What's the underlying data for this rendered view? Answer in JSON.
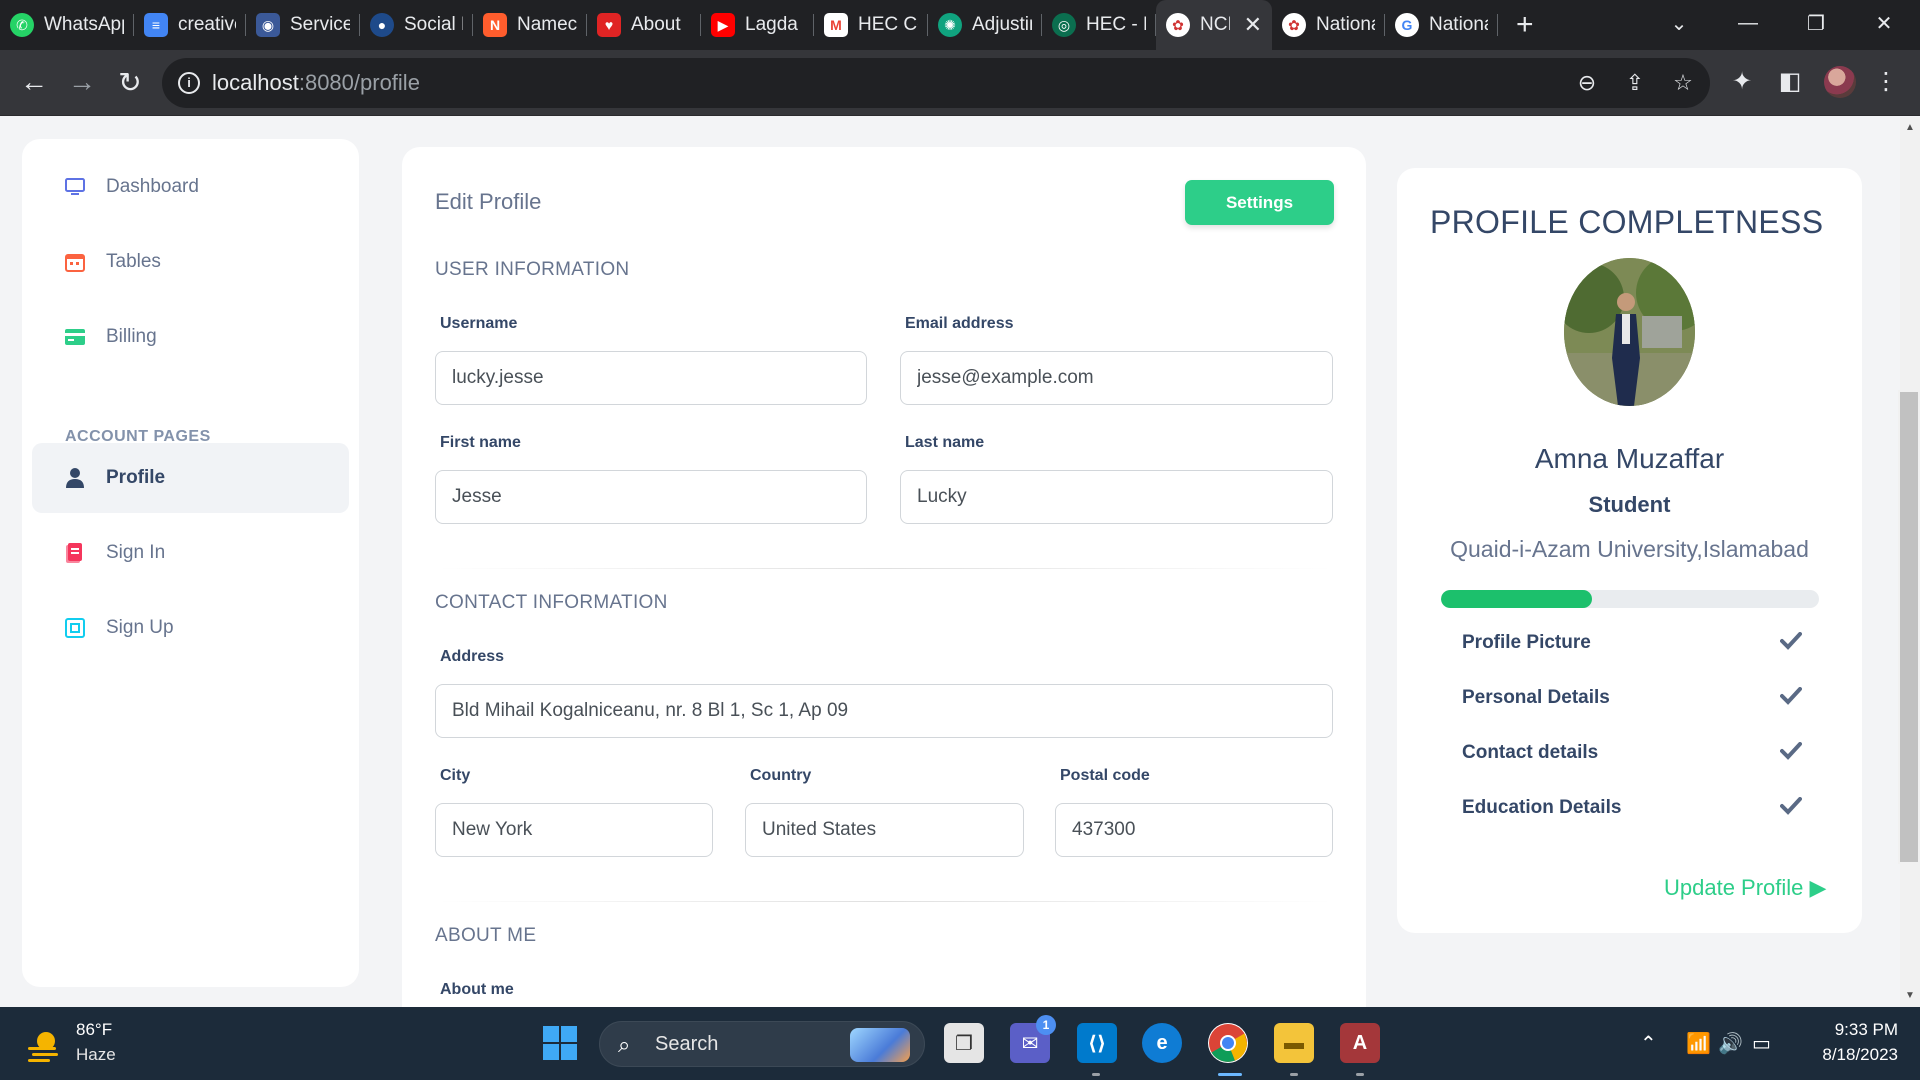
{
  "browser": {
    "tabs": [
      {
        "label": "WhatsApp",
        "color": "#25d366",
        "icon": "whatsapp-icon"
      },
      {
        "label": "creative",
        "color": "#4285f4",
        "icon": "docs-icon"
      },
      {
        "label": "Services",
        "color": "#3b5998",
        "icon": "services-icon"
      },
      {
        "label": "Social Media",
        "color": "#1e4a8a",
        "icon": "social-icon"
      },
      {
        "label": "Namecheap",
        "color": "#ff5d2d",
        "icon": "namecheap-icon"
      },
      {
        "label": "About",
        "color": "#e02424",
        "icon": "about-icon"
      },
      {
        "label": "Lagda",
        "color": "#ff0000",
        "icon": "youtube-icon"
      },
      {
        "label": "HEC Core",
        "color": "#ea4335",
        "icon": "gmail-icon"
      },
      {
        "label": "Adjusting",
        "color": "#10a37f",
        "icon": "chatgpt-icon"
      },
      {
        "label": "HEC - Portal",
        "color": "#0b6e4f",
        "icon": "hec-icon"
      },
      {
        "label": "NCI",
        "color": "#d03232",
        "icon": "nci-icon",
        "active": true
      },
      {
        "label": "National",
        "color": "#d03232",
        "icon": "nci-icon"
      },
      {
        "label": "National",
        "color": "#4285f4",
        "icon": "google-icon"
      }
    ],
    "url_host": "localhost",
    "url_path": ":8080/profile"
  },
  "sidebar": {
    "items": [
      {
        "label": "Dashboard",
        "icon": "monitor-icon",
        "color": "#5e72e4"
      },
      {
        "label": "Tables",
        "icon": "calendar-icon",
        "color": "#fb6340"
      },
      {
        "label": "Billing",
        "icon": "credit-card-icon",
        "color": "#2dce89"
      }
    ],
    "section_label": "ACCOUNT PAGES",
    "account_items": [
      {
        "label": "Profile",
        "icon": "user-icon",
        "color": "#344767",
        "active": true
      },
      {
        "label": "Sign In",
        "icon": "document-icon",
        "color": "#f5365c"
      },
      {
        "label": "Sign Up",
        "icon": "collection-icon",
        "color": "#11cdef"
      }
    ]
  },
  "edit_profile": {
    "title": "Edit Profile",
    "settings_label": "Settings",
    "user_section": "USER INFORMATION",
    "username_label": "Username",
    "username_value": "lucky.jesse",
    "email_label": "Email address",
    "email_value": "jesse@example.com",
    "first_name_label": "First name",
    "first_name_value": "Jesse",
    "last_name_label": "Last name",
    "last_name_value": "Lucky",
    "contact_section": "CONTACT INFORMATION",
    "address_label": "Address",
    "address_value": "Bld Mihail Kogalniceanu, nr. 8 Bl 1, Sc 1, Ap 09",
    "city_label": "City",
    "city_value": "New York",
    "country_label": "Country",
    "country_value": "United States",
    "postal_label": "Postal code",
    "postal_value": "437300",
    "about_section": "ABOUT ME",
    "about_label": "About me"
  },
  "profile_completeness": {
    "title": "PROFILE COMPLETNESS",
    "name": "Amna Muzaffar",
    "role": "Student",
    "university": "Quaid-i-Azam University,Islamabad",
    "progress_fraction": 0.4,
    "progress_color": "#1cc06c",
    "items": [
      "Profile Picture",
      "Personal Details",
      "Contact details",
      "Education Details"
    ],
    "update_label": "Update Profile"
  },
  "taskbar": {
    "temperature": "86°F",
    "weather": "Haze",
    "search_label": "Search",
    "time": "9:33 PM",
    "date": "8/18/2023",
    "teams_badge": "1"
  }
}
